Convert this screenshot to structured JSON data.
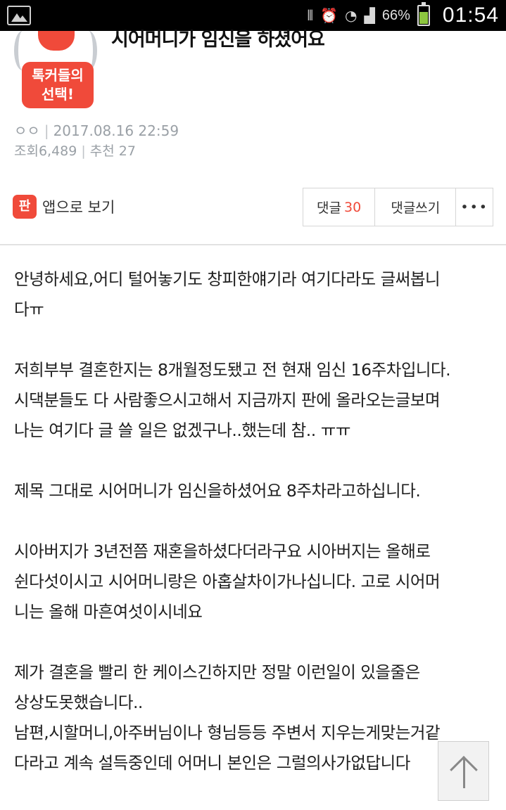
{
  "status_bar": {
    "battery_percent": "66%",
    "battery_level": 0.66,
    "time": "01:54",
    "icons": [
      "gallery-icon",
      "vibrate-icon",
      "alarm-icon",
      "wifi-icon",
      "signal-icon",
      "battery-icon"
    ]
  },
  "post": {
    "badge_line1": "톡커들의",
    "badge_line2": "선택!",
    "title": "시어머니가 임신을 하셨어요",
    "author": "ㅇㅇ",
    "date": "2017.08.16 22:59",
    "views_label": "조회",
    "views": "6,489",
    "recommend_label": "추천",
    "recommend": "27"
  },
  "actions": {
    "app_icon_text": "판",
    "app_view_label": "앱으로 보기",
    "comments_label": "댓글",
    "comments_count": "30",
    "write_comment_label": "댓글쓰기",
    "more_label": "•••"
  },
  "content": {
    "lines": [
      "안녕하세요,어디 털어놓기도 창피한얘기라 여기다라도 글써봅니",
      "다ㅠ",
      "",
      "저희부부 결혼한지는 8개월정도됐고 전 현재 임신 16주차입니다.",
      "시댁분들도 다 사람좋으시고해서 지금까지 판에 올라오는글보며",
      "나는 여기다 글 쓸 일은 없겠구나..했는데 참.. ㅠㅠ",
      "",
      "제목 그대로 시어머니가 임신을하셨어요 8주차라고하십니다.",
      "",
      "시아버지가 3년전쯤 재혼을하셨다더라구요 시아버지는 올해로",
      "쉰다섯이시고 시어머니랑은 아홉살차이가나십니다. 고로 시어머",
      "니는 올해 마흔여섯이시네요",
      "",
      "제가 결혼을 빨리 한 케이스긴하지만 정말 이런일이 있을줄은",
      "상상도못했습니다..",
      "남편,시할머니,아주버님이나 형님등등 주변서 지우는게맞는거같",
      "다라고 계속 설득중인데 어머니 본인은 그럴의사가없답니다"
    ]
  }
}
